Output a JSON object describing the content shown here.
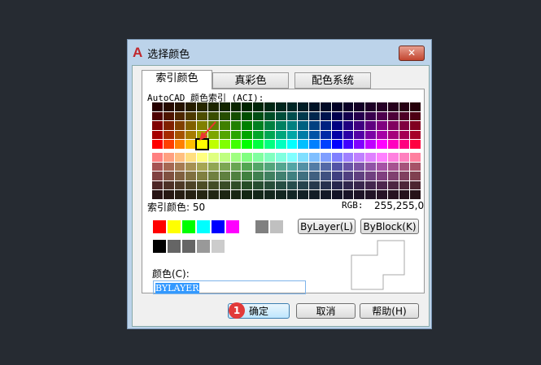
{
  "title": "选择颜色",
  "tabs": [
    {
      "label": "索引颜色"
    },
    {
      "label": "真彩色"
    },
    {
      "label": "配色系统"
    }
  ],
  "aci_label": "AutoCAD 颜色索引 (ACI):",
  "index_label": "索引颜色: 50",
  "rgb_label": "RGB:",
  "rgb_value": "255,255,0",
  "selected_index": 50,
  "standard_colors": [
    "#ff0000",
    "#ffff00",
    "#00ff00",
    "#00ffff",
    "#0000ff",
    "#ff00ff",
    "#ffffff",
    "#808080",
    "#c0c0c0"
  ],
  "gray_colors": [
    "#000000",
    "#656565",
    "#656565",
    "#999999",
    "#cccccc",
    "#ffffff"
  ],
  "bylayer_label": "ByLayer(L)",
  "byblock_label": "ByBlock(K)",
  "color_label": "颜色(C):",
  "color_value": "BYLAYER",
  "ok_label": "确定",
  "cancel_label": "取消",
  "help_label": "帮助(H)",
  "step_badge": "1",
  "accent": "#3399ff"
}
